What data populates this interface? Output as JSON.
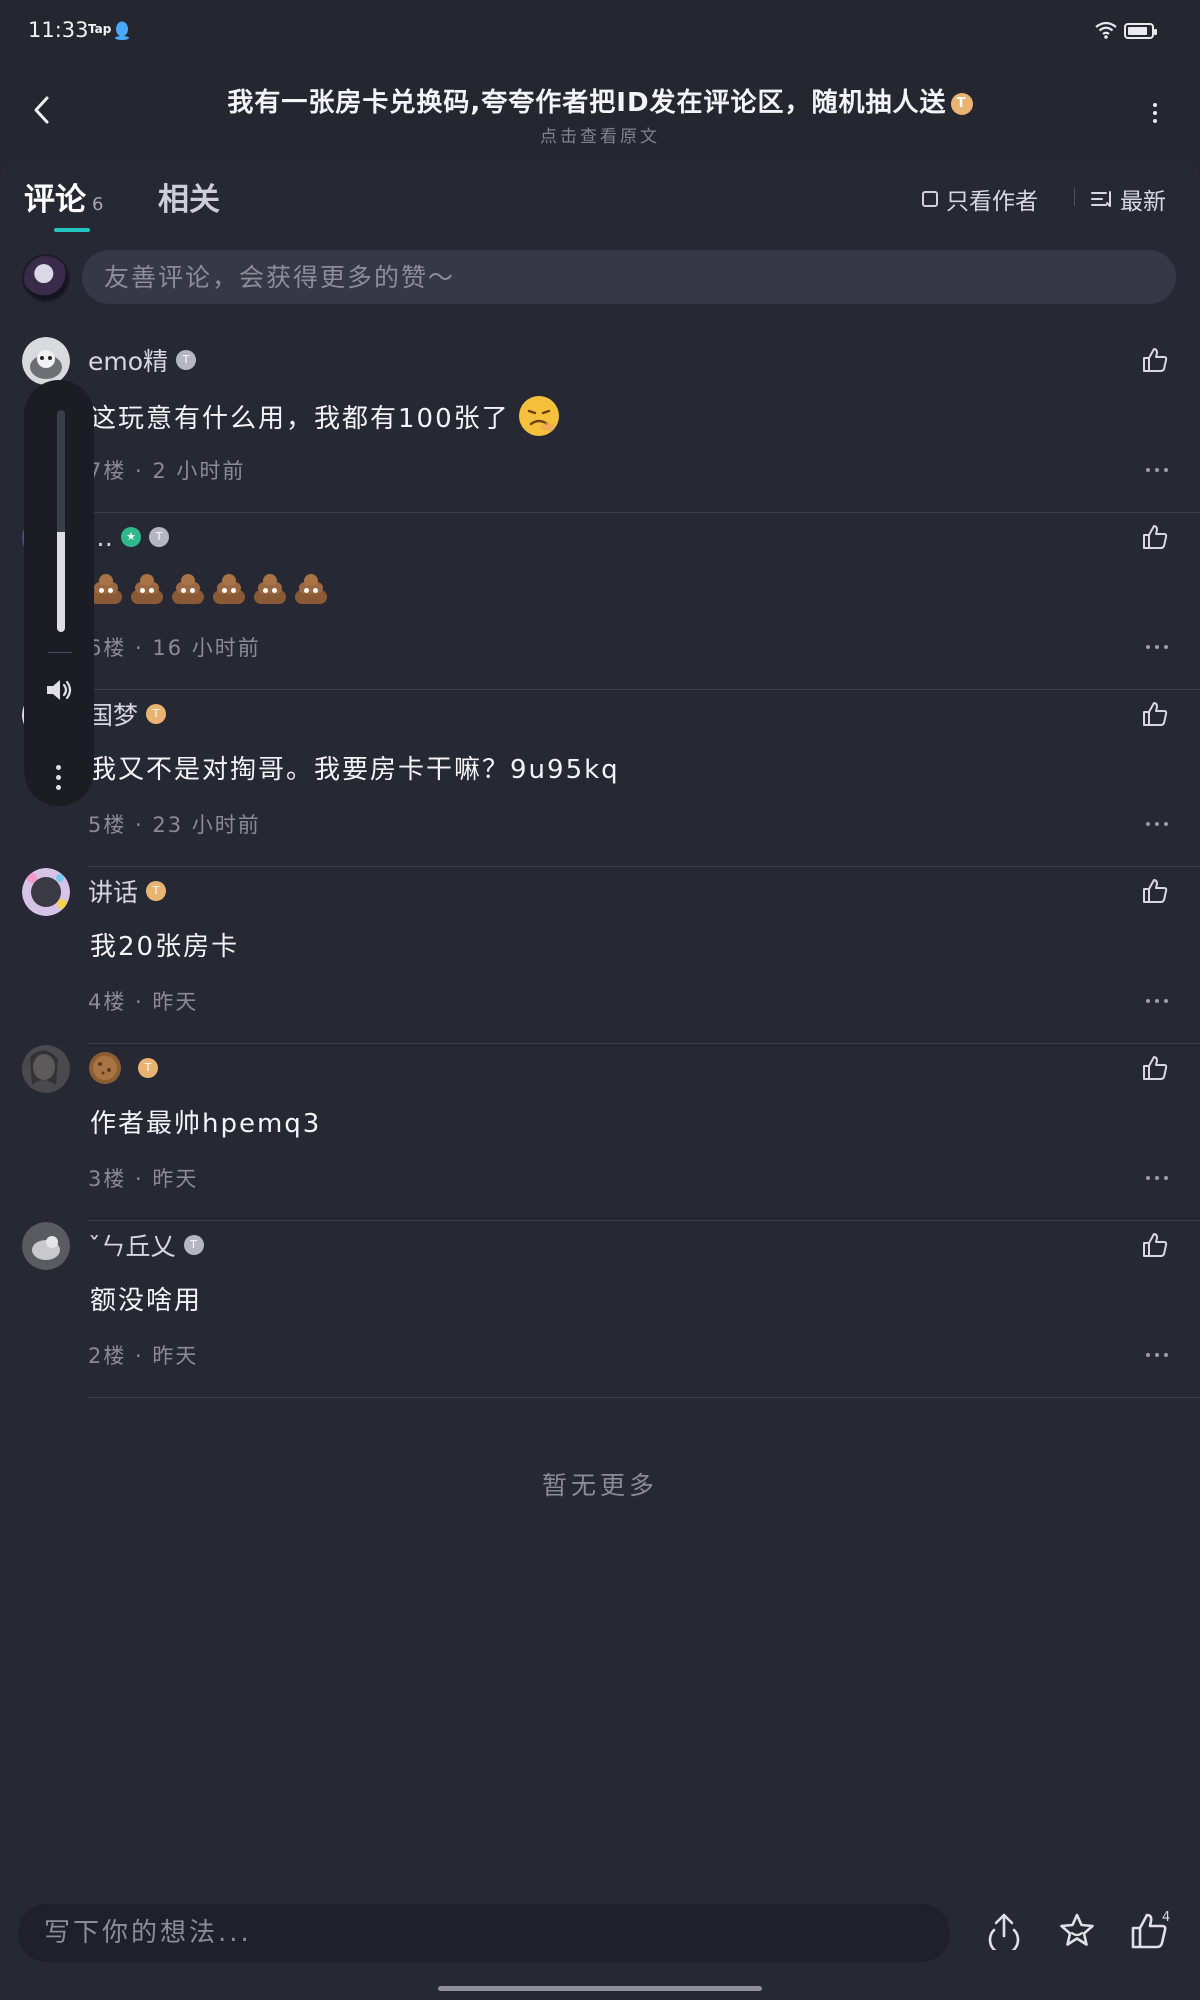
{
  "status_bar": {
    "time": "11:33",
    "app_label": "Tap",
    "icons": [
      "qq-icon",
      "wifi-icon",
      "battery-icon"
    ]
  },
  "header": {
    "title": "我有一张房卡兑换码,夸夸作者把ID发在评论区，随机抽人送",
    "title_badge": "T",
    "subtitle": "点击查看原文",
    "icons": [
      "back-arrow-icon",
      "more-vertical-icon"
    ]
  },
  "tabs": {
    "comments_label": "评论",
    "comments_count": "6",
    "related_label": "相关",
    "author_only_label": "只看作者",
    "sort_label": "最新",
    "accent_color": "#23c6c2"
  },
  "comment_input": {
    "placeholder": "友善评论，会获得更多的赞～"
  },
  "comments": [
    {
      "name": "emo精",
      "badge": "T",
      "content": "这玩意有什么用，我都有100张了",
      "emoji": "persevering-face-emoji",
      "meta": "7楼 · 2 小时前"
    },
    {
      "name": "…",
      "badge": "T",
      "content": "",
      "emoji": "pile-of-poo-emoji",
      "emoji_count": 6,
      "meta": "6楼 · 16 小时前"
    },
    {
      "name": "国梦",
      "badge": "T",
      "content": "我又不是对掏哥。我要房卡干嘛？9u95kq",
      "meta": "5楼 · 23 小时前"
    },
    {
      "name": "讲话",
      "badge": "T",
      "content": "我20张房卡",
      "meta": "4楼 · 昨天"
    },
    {
      "name": "",
      "badge": "T",
      "content": "作者最帅hpemq3",
      "meta": "3楼 · 昨天"
    },
    {
      "name": "ˇㄣ丘乂",
      "badge": "T",
      "content": "额没啥用",
      "meta": "2楼 · 昨天"
    }
  ],
  "no_more": "暂无更多",
  "volume": {
    "level": 0.45,
    "icons": [
      "speaker-icon",
      "more-vertical-icon"
    ]
  },
  "bottom_bar": {
    "placeholder": "写下你的想法...",
    "like_count": "4",
    "icons": [
      "share-icon",
      "favorite-star-icon",
      "thumbs-up-icon"
    ]
  },
  "colors": {
    "background": "#25262f",
    "panel": "#262833",
    "input": "#363845",
    "badge_gold": "#e9b372",
    "badge_grey": "#b4b6c2"
  }
}
